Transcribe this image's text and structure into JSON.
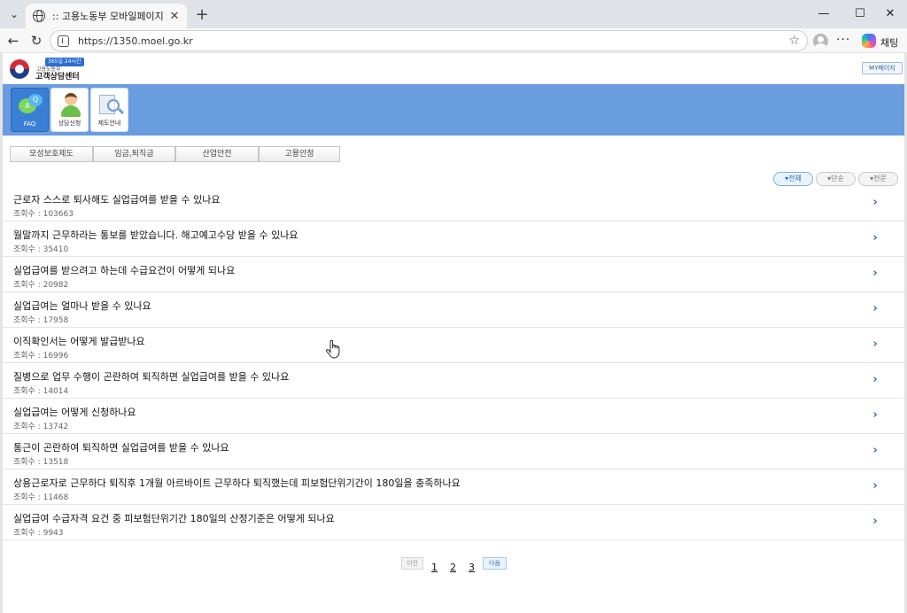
{
  "browser": {
    "tab_title": ":: 고용노동부 모바일페이지 고객상",
    "tab_close": "✕",
    "new_tab": "+",
    "tab_list": "⌄",
    "window_minimize": "—",
    "window_maximize": "☐",
    "window_close": "✕",
    "nav_back": "←",
    "nav_reload": "↻",
    "url": "https://1350.moel.go.kr",
    "more": "···",
    "copilot_label": "채팅"
  },
  "header": {
    "badge": "365일 24시간",
    "org": "고용노동부",
    "title": "고객상담센터",
    "mypage": "MY페이지"
  },
  "menu": [
    {
      "label": "FAQ",
      "active": true
    },
    {
      "label": "상담신청",
      "active": false
    },
    {
      "label": "제도안내",
      "active": false
    }
  ],
  "categories": [
    "모성보호제도",
    "임금,퇴직금",
    "산업안전",
    "고용안정"
  ],
  "filters": [
    {
      "label": "▾전체",
      "active": true
    },
    {
      "label": "▾단순",
      "active": false
    },
    {
      "label": "▾전문",
      "active": false
    }
  ],
  "faq_items": [
    {
      "question": "근로자 스스로 퇴사해도 실업급여를 받을 수 있나요",
      "views": "조회수 : 103663"
    },
    {
      "question": "월말까지 근무하라는 통보를 받았습니다. 해고예고수당 받을 수 있나요",
      "views": "조회수 : 35410"
    },
    {
      "question": "실업급여를 받으려고 하는데 수급요건이 어떻게 되나요",
      "views": "조회수 : 20982"
    },
    {
      "question": "실업급여는 얼마나 받을 수 있나요",
      "views": "조회수 : 17958"
    },
    {
      "question": "이직확인서는 어떻게 발급받나요",
      "views": "조회수 : 16996"
    },
    {
      "question": "질병으로 업무 수행이 곤란하여 퇴직하면 실업급여를 받을 수 있나요",
      "views": "조회수 : 14014"
    },
    {
      "question": "실업급여는 어떻게 신청하나요",
      "views": "조회수 : 13742"
    },
    {
      "question": "통근이 곤란하여 퇴직하면 실업급여를 받을 수 있나요",
      "views": "조회수 : 13518"
    },
    {
      "question": "상용근로자로 근무하다 퇴직후 1개월 아르바이트 근무하다 퇴직했는데 피보험단위기간이 180일을 충족하나요",
      "views": "조회수 : 11468"
    },
    {
      "question": "실업급여 수급자격 요건 중 피보험단위기간 180일의 산정기준은 어떻게 되나요",
      "views": "조회수 : 9943"
    }
  ],
  "chevron": "›",
  "pagination": {
    "prev": "이전",
    "pages": [
      "1",
      "2",
      "3"
    ],
    "next": "다음"
  },
  "colors": {
    "menu_band": "#6a9ce0",
    "accent": "#2a6cb8"
  }
}
